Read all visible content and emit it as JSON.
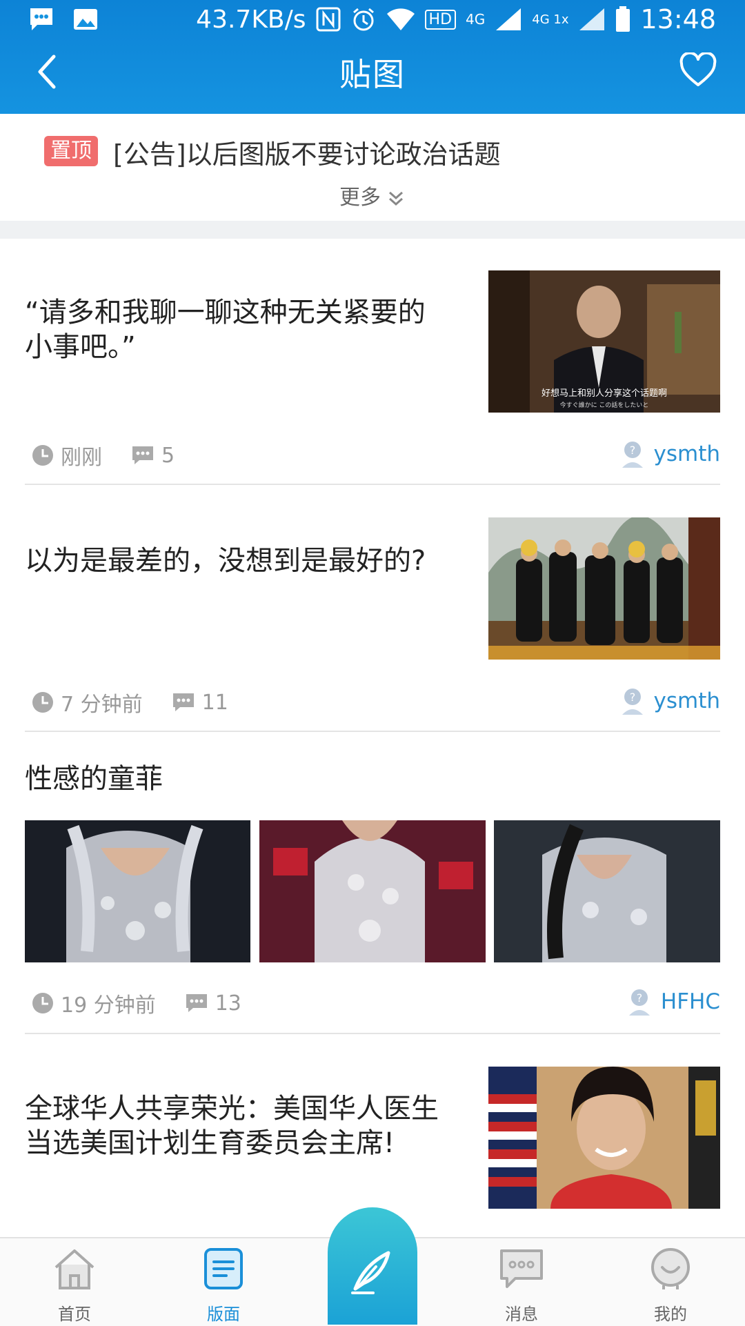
{
  "status_bar": {
    "speed": "43.7KB/s",
    "hd_label": "HD",
    "net1": "4G",
    "net2": "4G 1x",
    "time": "13:48"
  },
  "header": {
    "title": "贴图"
  },
  "pinned": {
    "tag": "置顶",
    "title": "[公告]以后图版不要讨论政治话题",
    "more": "更多"
  },
  "posts": [
    {
      "title_line1": "“请多和我聊一聊这种无关紧要的",
      "title_line2": "小事吧。”",
      "time": "刚刚",
      "comments": "5",
      "author": "ysmth",
      "subtitle1": "好想马上和别人分享这个话题啊",
      "subtitle2": "今すぐ誰かに この話をしたいと"
    },
    {
      "title_line1": "以为是最差的，没想到是最好的?",
      "time": "7 分钟前",
      "comments": "11",
      "author": "ysmth"
    },
    {
      "title_line1": "性感的童菲",
      "time": "19 分钟前",
      "comments": "13",
      "author": "HFHC"
    },
    {
      "title_line1": "全球华人共享荣光：美国华人医生",
      "title_line2": "当选美国计划生育委员会主席!"
    }
  ],
  "tabs": [
    {
      "label": "首页"
    },
    {
      "label": "版面"
    },
    {
      "label": "消息"
    },
    {
      "label": "我的"
    }
  ],
  "colors": {
    "header_blue": "#1593e0",
    "accent": "#1a8fd8",
    "pin_tag": "#f06d6d"
  }
}
